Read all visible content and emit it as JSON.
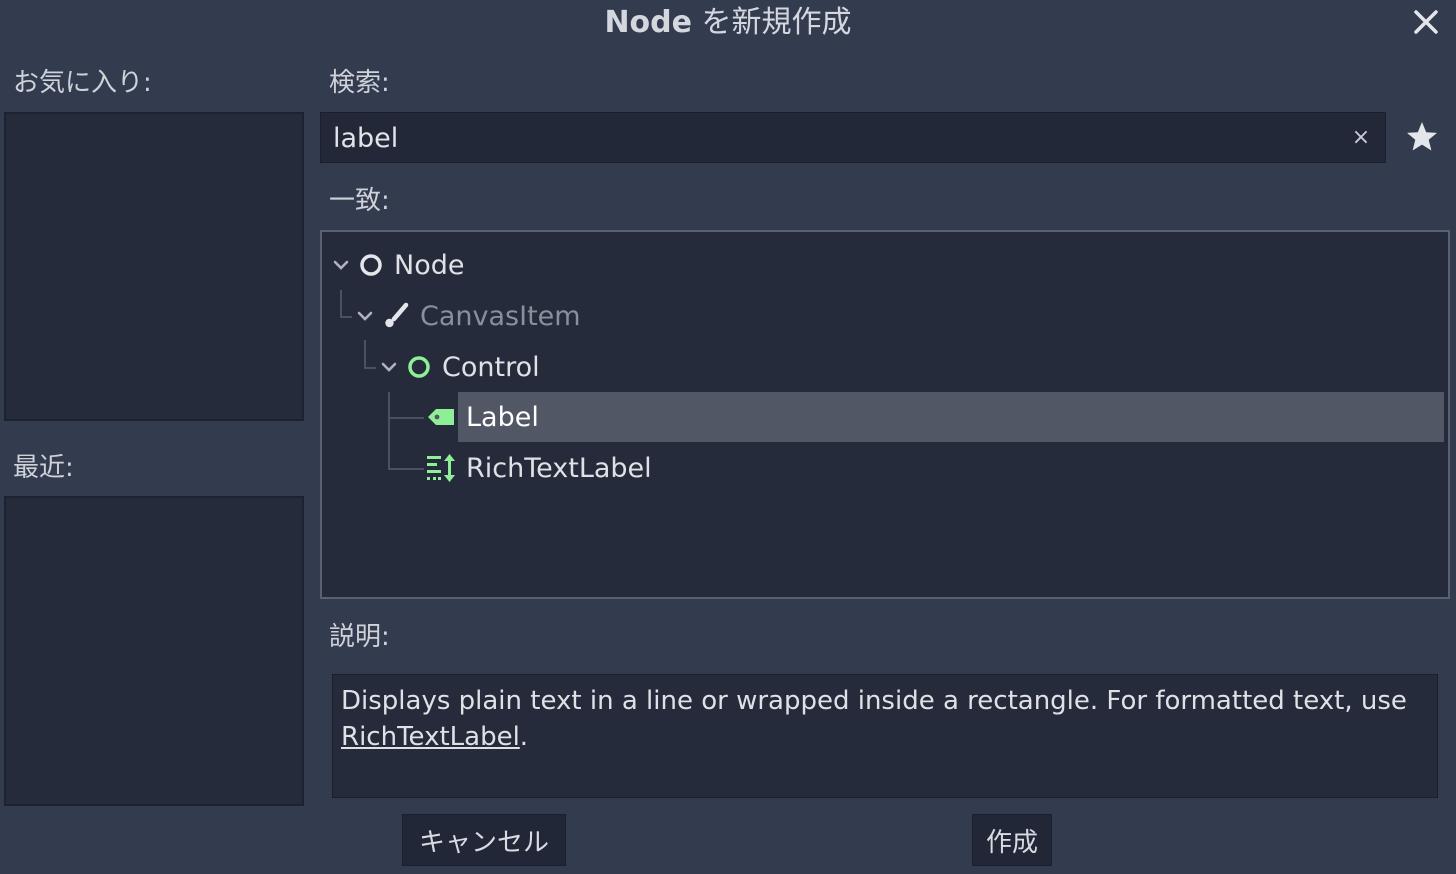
{
  "dialog": {
    "title_bold": "Node",
    "title_rest": " を新規作成",
    "close_icon": "close-icon"
  },
  "sidebar": {
    "favorites_label": "お気に入り:",
    "recent_label": "最近:"
  },
  "search": {
    "label": "検索:",
    "value": "label",
    "clear_glyph": "×",
    "favorite_icon": "star-icon"
  },
  "matches": {
    "label": "一致:",
    "tree": [
      {
        "label": "Node",
        "icon": "node-circle-icon",
        "level": 0,
        "expanded": true,
        "selected": false,
        "disabled": false
      },
      {
        "label": "CanvasItem",
        "icon": "brush-icon",
        "level": 1,
        "expanded": true,
        "selected": false,
        "disabled": true
      },
      {
        "label": "Control",
        "icon": "control-circle-icon",
        "level": 2,
        "expanded": true,
        "selected": false,
        "disabled": false
      },
      {
        "label": "Label",
        "icon": "label-tag-icon",
        "level": 3,
        "expanded": false,
        "selected": true,
        "disabled": false
      },
      {
        "label": "RichTextLabel",
        "icon": "rich-text-icon",
        "level": 3,
        "expanded": false,
        "selected": false,
        "disabled": false
      }
    ]
  },
  "description": {
    "label": "説明:",
    "text": "Displays plain text in a line or wrapped inside a rectangle. For formatted text, use ",
    "link": "RichTextLabel",
    "suffix": "."
  },
  "buttons": {
    "cancel": "キャンセル",
    "create": "作成"
  },
  "colors": {
    "background": "#333b4f",
    "panel": "#252b3a",
    "accent_green": "#8eef97",
    "selection": "#525766",
    "disabled_text": "#8a8f9c"
  }
}
